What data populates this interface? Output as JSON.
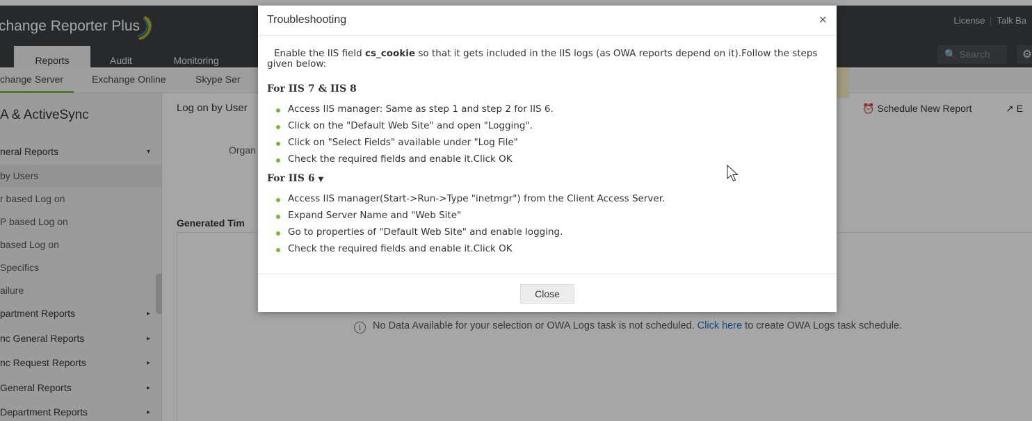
{
  "header": {
    "brand": "change Reporter Plus",
    "links": [
      "License",
      "Talk Ba"
    ],
    "nav_tabs": [
      "Reports",
      "Audit",
      "Monitoring"
    ],
    "search_placeholder": "Search"
  },
  "subnav": {
    "items": [
      "change Server",
      "Exchange Online",
      "Skype Ser"
    ]
  },
  "sidebar": {
    "title": "A & ActiveSync",
    "items": [
      {
        "label": "neral Reports",
        "type": "group",
        "caret": "▾"
      },
      {
        "label": "by Users",
        "type": "sub",
        "selected": true
      },
      {
        "label": "r based Log on",
        "type": "sub"
      },
      {
        "label": "P based Log on",
        "type": "sub"
      },
      {
        "label": "based Log on",
        "type": "sub"
      },
      {
        "label": "Specifics",
        "type": "sub"
      },
      {
        "label": "ailure",
        "type": "sub"
      },
      {
        "label": "partment Reports",
        "type": "group",
        "caret": "▸"
      },
      {
        "label": "nc General Reports",
        "type": "group",
        "caret": "▸"
      },
      {
        "label": "nc Request Reports",
        "type": "group",
        "caret": "▸"
      },
      {
        "label": "General Reports",
        "type": "group",
        "caret": "▸"
      },
      {
        "label": "Department Reports",
        "type": "group",
        "caret": "▸"
      }
    ]
  },
  "main": {
    "title": "Log on by User",
    "org_label": "Organ",
    "generated_time_label": "Generated Tim",
    "schedule_label": "Schedule New Report",
    "export_label": "E",
    "no_data": {
      "text_before": "No Data Available for your selection or OWA Logs task is not scheduled.",
      "link": "Click here",
      "text_after": "to create OWA Logs task schedule."
    }
  },
  "modal": {
    "title": "Troubleshooting",
    "close_glyph": "×",
    "intro_before": "Enable the IIS field",
    "intro_field": "cs_cookie",
    "intro_after": "so that it gets included in the IIS logs (as OWA reports depend on it).Follow the steps given below:",
    "section1": {
      "title": "For IIS 7 & IIS 8",
      "steps": [
        "Access IIS manager: Same as step 1 and step 2 for IIS 6.",
        "Click on the \"Default Web Site\" and open \"Logging\".",
        "Click on \"Select Fields\" available under \"Log File\"",
        "Check the required fields and enable it.Click OK"
      ]
    },
    "section2": {
      "title": "For IIS 6",
      "steps": [
        "Access IIS manager(Start->Run->Type \"inetmgr\") from the Client Access Server.",
        "Expand Server Name and \"Web Site\"",
        "Go to properties of \"Default Web Site\" and enable logging.",
        "Check the required fields and enable it.Click OK"
      ]
    },
    "close_button": "Close"
  },
  "colors": {
    "header_bg": "#3d3f41",
    "accent_green": "#7cb342",
    "link_blue": "#1a73c4"
  }
}
